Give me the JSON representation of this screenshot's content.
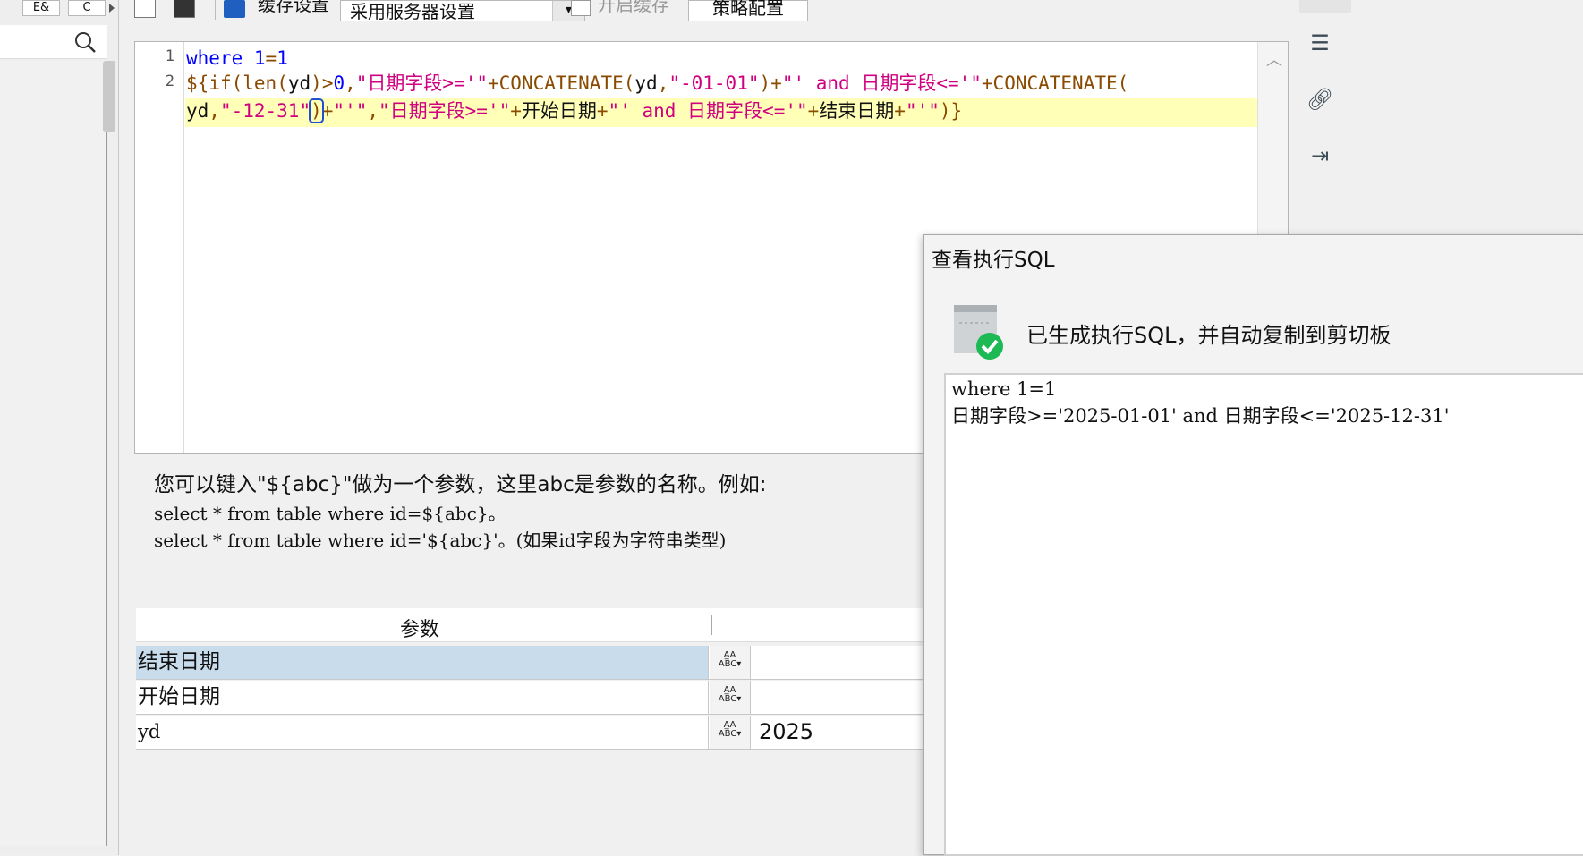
{
  "left_panel": {
    "btn_a": "E&",
    "btn_b": "C",
    "search_icon": "search-icon"
  },
  "toolbar": {
    "icons": [
      "preview-icon",
      "save-icon",
      "cache-settings-icon"
    ],
    "cache_label": "缓存设置",
    "cache_select_value": "采用服务器设置",
    "enable_cache_label": "开启缓存",
    "strategy_button": "策略配置"
  },
  "editor": {
    "line_numbers": [
      "1",
      "2"
    ],
    "line1": "where 1=1",
    "line2": "${if(len(yd)>0,\"日期字段>='\"+CONCATENATE(yd,\"-01-01\")+\"' and 日期字段<='\"+CONCATENATE(",
    "line3": "yd,\"-12-31\")+\"'\",\"日期字段>='\"+开始日期+\"' and 日期字段<='\"+结束日期+\"'\")}"
  },
  "right_toolbar": {
    "icons": [
      "format-icon",
      "link-icon",
      "export-icon"
    ]
  },
  "hint": {
    "title": "您可以键入\"${abc}\"做为一个参数，这里abc是参数的名称。例如:",
    "example1": "select * from table where id=${abc}。",
    "example2": "select * from table where id='${abc}'。(如果id字段为字符串类型)"
  },
  "params": {
    "header": "参数",
    "rows": [
      {
        "name": "结束日期",
        "type_icon": "abc-type-icon",
        "value": ""
      },
      {
        "name": "开始日期",
        "type_icon": "abc-type-icon",
        "value": ""
      },
      {
        "name": "yd",
        "type_icon": "abc-type-icon",
        "value": "2025"
      }
    ]
  },
  "dialog": {
    "title": "查看执行SQL",
    "message": "已生成执行SQL，并自动复制到剪切板",
    "sql_line1": "where 1=1",
    "sql_line2": "日期字段>='2025-01-01' and 日期字段<='2025-12-31'"
  },
  "colors": {
    "keyword": "#0000ff",
    "string": "#d00080",
    "function": "#8a4a00",
    "highlight": "#ffffb8",
    "selected_row": "#c9dcec",
    "success": "#1db954"
  }
}
